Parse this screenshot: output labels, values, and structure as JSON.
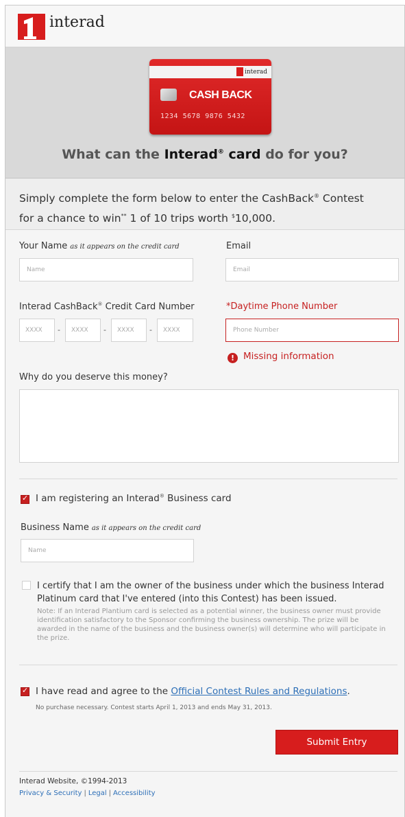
{
  "header": {
    "logo_text": "interad"
  },
  "hero": {
    "card_brand": "interad",
    "card_title": "CASH BACK",
    "card_number": "1234 5678 9876 5432",
    "headline_pre": "What can the ",
    "headline_brand": "Interad",
    "headline_reg": "®",
    "headline_card": " card",
    "headline_post": " do for you?"
  },
  "intro": {
    "line1_pre": "Simply complete the form below to enter the CashBack",
    "line1_reg": "®",
    "line1_post": " Contest",
    "line2_pre": "for a chance to win",
    "line2_mark": "**",
    "line2_mid": " 1 of 10 trips worth ",
    "line2_dollar": "$",
    "line2_post": "10,000."
  },
  "form": {
    "name_label": "Your Name",
    "name_hint": "as it appears on the credit card",
    "name_placeholder": "Name",
    "email_label": "Email",
    "email_placeholder": "Email",
    "ccn_label_pre": "Interad CashBack",
    "ccn_label_reg": "®",
    "ccn_label_post": " Credit Card Number",
    "ccn_placeholders": [
      "XXXX",
      "XXXX",
      "XXXX",
      "XXXX"
    ],
    "ccn_separator": "-",
    "phone_label": "*Daytime Phone Number",
    "phone_placeholder": "Phone Number",
    "phone_error": "Missing information",
    "error_icon_glyph": "!",
    "deserve_label": "Why do you deserve this money?",
    "business_check_pre": "I am registering an Interad",
    "business_check_reg": "®",
    "business_check_post": " Business card",
    "business_check_checked": true,
    "business_name_label": "Business Name",
    "business_name_hint": "as it appears on the credit card",
    "business_name_placeholder": "Name",
    "certify_checked": false,
    "certify_text": "I certify that I am the owner of the business under which the business Interad Platinum card that I've entered (into this Contest) has been issued.",
    "certify_note": "Note: If an Interad Plantium card is selected as a potential winner, the business owner must provide identification satisfactory to the Sponsor confirming the business ownership. The prize will be awarded in the name of the business and the business owner(s) will determine who will participate in the prize.",
    "agree_checked": true,
    "agree_pre": "I have read and agree to the ",
    "agree_link": "Official Contest Rules and Regulations",
    "agree_post": ".",
    "fine_print": "No purchase necessary. Contest starts April 1, 2013 and ends May 31, 2013.",
    "submit_label": "Submit Entry"
  },
  "footer": {
    "copyright": "Interad Website, ©1994-2013",
    "links": [
      "Privacy & Security",
      "Legal",
      "Accessibility"
    ],
    "link_separator": "|"
  },
  "colors": {
    "brand_red": "#d71d1d",
    "error_red": "#c62020",
    "link_blue": "#2d6fb7"
  }
}
